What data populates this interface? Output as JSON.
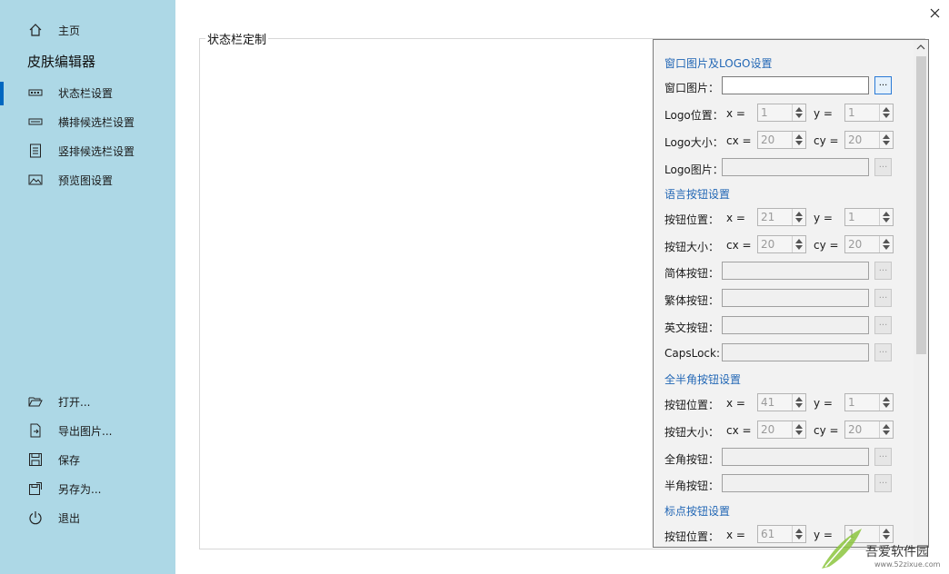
{
  "window": {
    "close_icon": "close-icon"
  },
  "sidebar": {
    "home": {
      "label": "主页",
      "icon": "home-icon"
    },
    "app_title": "皮肤编辑器",
    "items": [
      {
        "label": "状态栏设置",
        "icon": "statusbar-icon",
        "selected": true
      },
      {
        "label": "横排候选栏设置",
        "icon": "horizontal-bar-icon",
        "selected": false
      },
      {
        "label": "竖排候选栏设置",
        "icon": "vertical-bar-icon",
        "selected": false
      },
      {
        "label": "预览图设置",
        "icon": "image-icon",
        "selected": false
      }
    ],
    "actions": [
      {
        "label": "打开...",
        "icon": "open-folder-icon"
      },
      {
        "label": "导出图片...",
        "icon": "export-image-icon"
      },
      {
        "label": "保存",
        "icon": "save-icon"
      },
      {
        "label": "另存为...",
        "icon": "save-as-icon"
      },
      {
        "label": "退出",
        "icon": "power-icon"
      }
    ],
    "accent_color": "#0067c0",
    "background_color": "#add8e6"
  },
  "main": {
    "group_title": "状态栏定制",
    "panel": {
      "section_window": "窗口图片及LOGO设置",
      "window_image_label": "窗口图片：",
      "logo_pos_label": "Logo位置：",
      "logo_size_label": "Logo大小：",
      "logo_image_label": "Logo图片：",
      "x_label": "x  =",
      "y_label": "y  =",
      "cx_label": "cx =",
      "cy_label": "cy =",
      "logo_x": "1",
      "logo_y": "1",
      "logo_cx": "20",
      "logo_cy": "20",
      "section_lang": "语言按钮设置",
      "btn_pos_label": "按钮位置：",
      "btn_size_label": "按钮大小：",
      "lang_x": "21",
      "lang_y": "1",
      "lang_cx": "20",
      "lang_cy": "20",
      "simplified_label": "简体按钮：",
      "traditional_label": "繁体按钮：",
      "english_label": "英文按钮：",
      "capslock_label": "CapsLock:",
      "section_width": "全半角按钮设置",
      "width_x": "41",
      "width_y": "1",
      "width_cx": "20",
      "width_cy": "20",
      "full_label": "全角按钮：",
      "half_label": "半角按钮：",
      "section_punct": "标点按钮设置",
      "punct_x": "61",
      "punct_y": "1",
      "browse_label": "...",
      "section_color": "#2267b5"
    }
  },
  "watermark": {
    "text": "吾爱软件园",
    "url": "www.52zixue.com"
  }
}
